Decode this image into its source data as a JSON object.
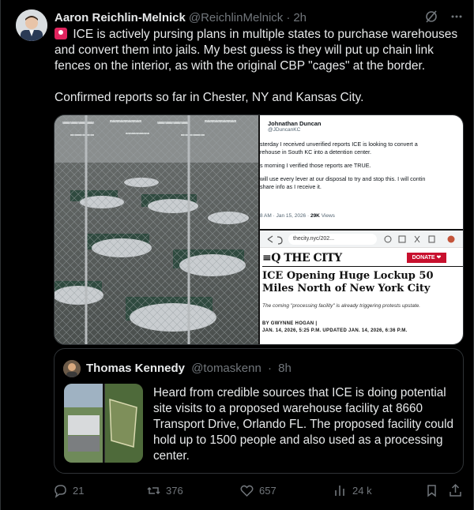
{
  "author": {
    "name": "Aaron Reichlin-Melnick",
    "handle": "@ReichlinMelnick",
    "time": "2h"
  },
  "tweet": {
    "line1": "ICE is actively pursing plans in multiple states to purchase warehouses and convert them into jails. My best guess is they will put up chain link fences on the interior, as with the original CBP \"cages\" at the border.",
    "line2": "Confirmed reports so far in Chester, NY and Kansas City."
  },
  "media": {
    "screenshot_tweet": {
      "name": "Johnathan Duncan",
      "handle": "@JDuncanKC",
      "lines": [
        "sterday I received unverified reports ICE is looking to convert a",
        "rehouse in South KC into a detention center.",
        "s morning I verified those reports are TRUE.",
        "will use every lever at our disposal to try and stop this. I will contin",
        "share info as I receive it."
      ],
      "meta_prefix": "8 AM · Jan 15, 2026 · ",
      "views_count": "29K",
      "views_label": " Views"
    },
    "article": {
      "url": "thecity.nyc/202...",
      "logo": "≡Q THE CITY",
      "donate": "DONATE ❤",
      "headline": "ICE Opening Huge Lockup 50 Miles North of New York City",
      "dek": "The coming \"processing facility\" is already triggering protests upstate.",
      "byline": "BY GWYNNE HOGAN   |",
      "dateline": "JAN. 14, 2026, 5:25 P.M.   UPDATED JAN. 14, 2026, 6:36 P.M."
    }
  },
  "quote": {
    "name": "Thomas Kennedy",
    "handle": "@tomaskenn",
    "time": "8h",
    "text": "Heard from credible sources that ICE is doing potential site visits to a proposed warehouse facility at 8660 Transport Drive, Orlando FL. The proposed facility could hold up to 1500 people and also used as a processing center."
  },
  "actions": {
    "replies": "21",
    "reposts": "376",
    "likes": "657",
    "views": "24 k"
  },
  "colors": {
    "background": "#000000",
    "text": "#e7e9ea",
    "muted": "#71767b",
    "border": "#2f3336",
    "siren": "#e0245e",
    "city_red": "#c8102e"
  },
  "icons": [
    "grok-icon",
    "more-icon",
    "siren-emoji",
    "reply-icon",
    "repost-icon",
    "like-icon",
    "views-icon",
    "bookmark-icon",
    "share-icon"
  ]
}
